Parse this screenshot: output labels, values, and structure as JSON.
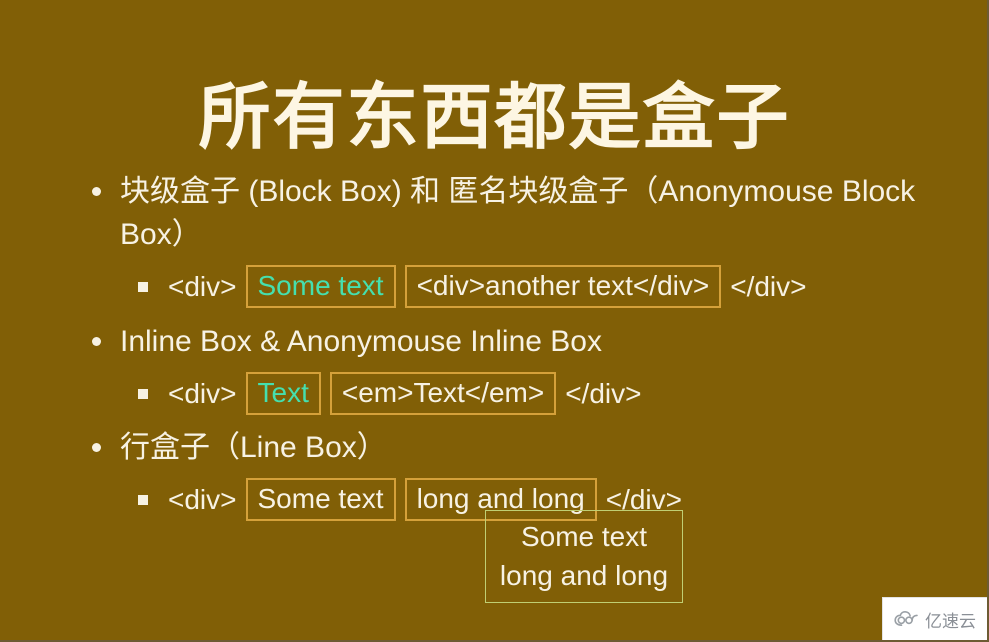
{
  "slide": {
    "background_color": "#815f06",
    "title": "所有东西都是盒子",
    "text_color": "#f7f2e4",
    "box_border_color": "#d5a13a",
    "anonymous_box_color": "#45dfae",
    "line_box_border_color": "#c0cf73"
  },
  "bullets": {
    "b1": {
      "label": "块级盒子 (Block Box) 和 匿名块级盒子（Anonymouse Block Box）",
      "sub": {
        "open_tag": "<div>",
        "boxed_anonymous": "Some text",
        "boxed_child": "<div>another text</div>",
        "close_tag": "</div>"
      }
    },
    "b2": {
      "label": "Inline Box & Anonymouse Inline Box",
      "sub": {
        "open_tag": "<div>",
        "boxed_anonymous": "Text",
        "boxed_child": "<em>Text</em>",
        "close_tag": "</div>"
      }
    },
    "b3": {
      "label": "行盒子（Line Box）",
      "sub": {
        "open_tag": "<div>",
        "boxed_first": "Some text",
        "boxed_second": "long and long",
        "close_tag": "</div>"
      }
    }
  },
  "line_box_demo": {
    "line1": "Some text",
    "line2": "long and long"
  },
  "watermark": {
    "text": "亿速云",
    "icon": "cloud-icon"
  }
}
